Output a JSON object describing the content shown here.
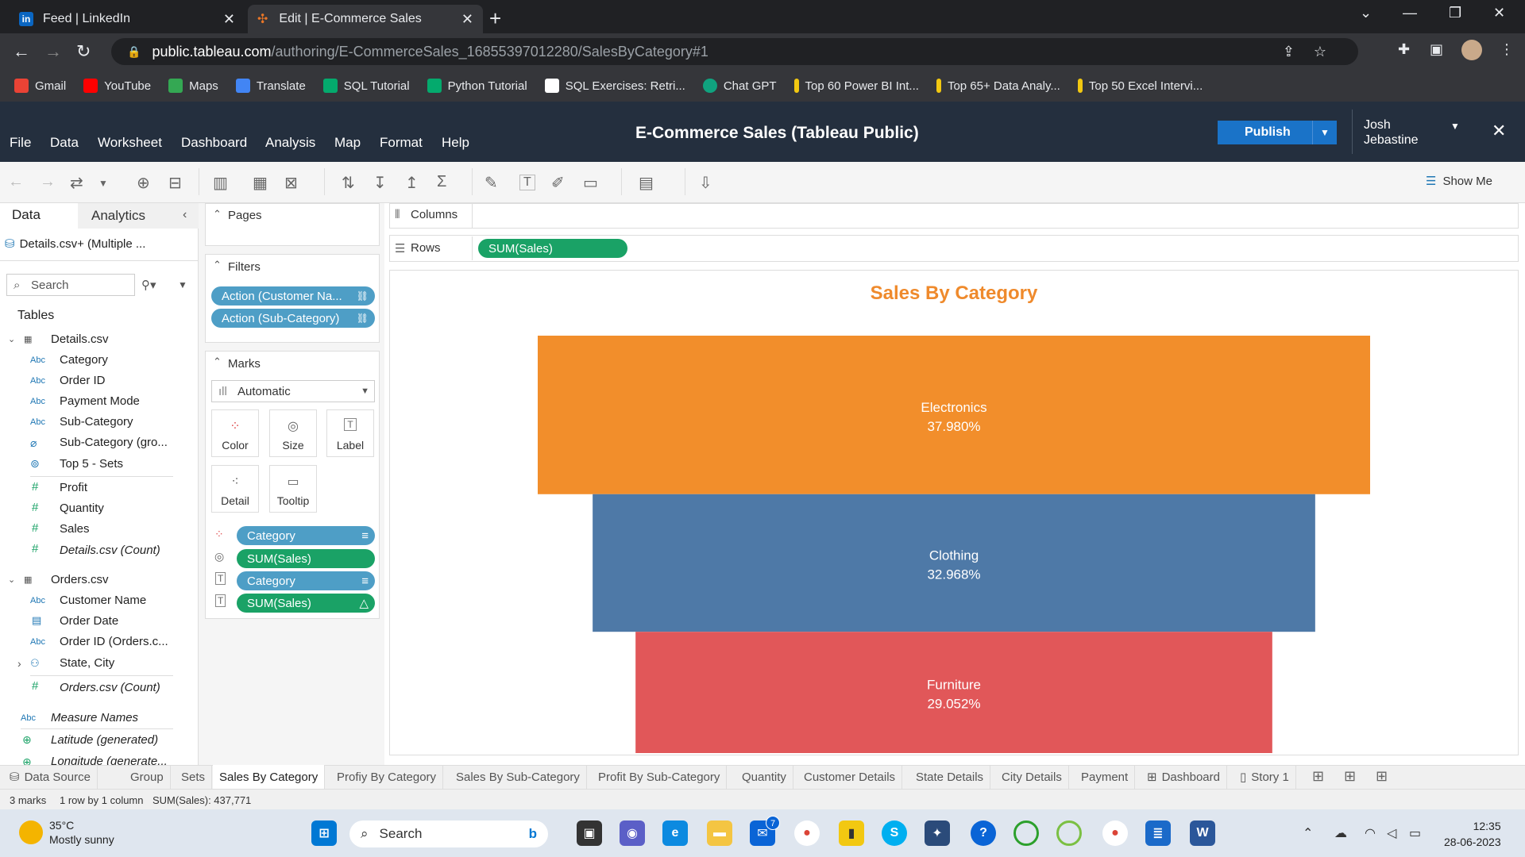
{
  "browser": {
    "tabs": [
      {
        "title": "Feed | LinkedIn",
        "favicon": "linkedin-icon"
      },
      {
        "title": "Edit | E-Commerce Sales",
        "favicon": "tableau-icon"
      }
    ],
    "url_host": "public.tableau.com",
    "url_path": "/authoring/E-CommerceSales_16855397012280/SalesByCategory#1",
    "bookmarks": [
      "Gmail",
      "YouTube",
      "Maps",
      "Translate",
      "SQL Tutorial",
      "Python Tutorial",
      "SQL Exercises: Retri...",
      "Chat GPT",
      "Top 60 Power BI Int...",
      "Top 65+ Data Analy...",
      "Top 50 Excel Intervi..."
    ]
  },
  "app": {
    "title": "E-Commerce Sales (Tableau Public)",
    "menu": [
      "File",
      "Data",
      "Worksheet",
      "Dashboard",
      "Analysis",
      "Map",
      "Format",
      "Help"
    ],
    "publish_label": "Publish",
    "user_first": "Josh",
    "user_last": "Jebastine",
    "show_me": "Show Me"
  },
  "data_pane": {
    "tab_data": "Data",
    "tab_analytics": "Analytics",
    "datasource": "Details.csv+ (Multiple ...",
    "search_placeholder": "Search",
    "tables_label": "Tables",
    "details_table": "Details.csv",
    "details_fields": [
      "Category",
      "Order ID",
      "Payment Mode",
      "Sub-Category",
      "Sub-Category (gro...",
      "Top 5 - Sets"
    ],
    "details_measures": [
      "Profit",
      "Quantity",
      "Sales",
      "Details.csv (Count)"
    ],
    "orders_table": "Orders.csv",
    "orders_fields": [
      "Customer Name",
      "Order Date",
      "Order ID (Orders.c...",
      "State, City"
    ],
    "orders_count": "Orders.csv (Count)",
    "measure_names": "Measure Names",
    "latitude": "Latitude (generated)",
    "longitude": "Longitude (generate..."
  },
  "shelves": {
    "pages": "Pages",
    "filters": "Filters",
    "filter_pills": [
      "Action (Customer Na...",
      "Action (Sub-Category)"
    ],
    "marks": "Marks",
    "mark_type": "Automatic",
    "mark_buttons": [
      "Color",
      "Size",
      "Label",
      "Detail",
      "Tooltip"
    ],
    "mark_pills": [
      "Category",
      "SUM(Sales)",
      "Category",
      "SUM(Sales)"
    ],
    "columns": "Columns",
    "rows": "Rows",
    "rows_pill": "SUM(Sales)"
  },
  "sheets": [
    "Data Source",
    "Group",
    "Sets",
    "Sales By Category",
    "Profiy By Category",
    "Sales By Sub-Category",
    "Profit By Sub-Category",
    "Quantity",
    "Customer Details",
    "State Details",
    "City Details",
    "Payment",
    "Dashboard",
    "Story 1"
  ],
  "status": {
    "marks": "3 marks",
    "dims": "1 row by 1 column",
    "sum": "SUM(Sales): 437,771"
  },
  "taskbar": {
    "temp": "35°C",
    "weather": "Mostly sunny",
    "search": "Search",
    "time": "12:35",
    "date": "28-06-2023",
    "mail_badge": "7"
  },
  "colors": {
    "electronics": "#f28e2b",
    "clothing": "#4e79a7",
    "furniture": "#e15759",
    "title": "#ef8a2c"
  },
  "chart_data": {
    "type": "bar",
    "title": "Sales By Category",
    "categories": [
      "Electronics",
      "Clothing",
      "Furniture"
    ],
    "values": [
      37.98,
      32.968,
      29.052
    ],
    "labels": [
      "37.980%",
      "32.968%",
      "29.052%"
    ],
    "unit": "percent of total SUM(Sales)"
  }
}
